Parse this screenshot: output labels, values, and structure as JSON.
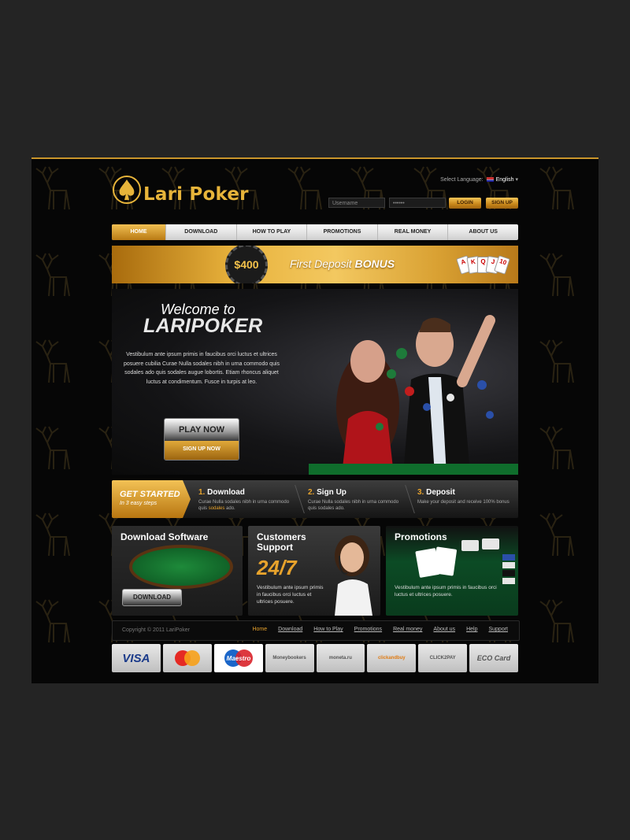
{
  "brand": {
    "name": "Lari Poker",
    "accent": "#e7b43a"
  },
  "language": {
    "label": "Select Language:",
    "value": "English"
  },
  "login": {
    "username_placeholder": "Username",
    "password_placeholder": "••••••",
    "login_label": "LOGIN",
    "signup_label": "SIGN UP"
  },
  "nav": {
    "items": [
      {
        "label": "HOME"
      },
      {
        "label": "DOWNLOAD"
      },
      {
        "label": "HOW TO PLAY"
      },
      {
        "label": "PROMOTIONS"
      },
      {
        "label": "REAL MONEY"
      },
      {
        "label": "ABOUT US"
      }
    ]
  },
  "bonus": {
    "amount": "$400",
    "text": "First Deposit",
    "bold": "BONUS",
    "cards": [
      "A",
      "K",
      "Q",
      "J",
      "10"
    ]
  },
  "hero": {
    "welcome": "Welcome to",
    "brand": "LARIPOKER",
    "paragraph": "Vestibulum ante ipsum primis in faucibus orci luctus et ultrices posuere cubilia Curae Nulla sodales nibh in urna commodo quis sodales ado quis sodales augue lobortis. Etiam rhoncus aliquet luctus at condimentum. Fusce in turpis at leo.",
    "play_label": "PLAY NOW",
    "signup_label": "SIGN UP NOW"
  },
  "get_started": {
    "title": "GET STARTED",
    "subtitle": "In 3 easy steps",
    "steps": [
      {
        "num": "1.",
        "title": "Download",
        "desc": "Curae Nulla sodales nibh in urna commodo quis",
        "highlight": "sodales",
        "tail": "ado."
      },
      {
        "num": "2.",
        "title": "Sign Up",
        "desc": "Curae Nulla sodales nibh in urna commodo quis sodales ado."
      },
      {
        "num": "3.",
        "title": "Deposit",
        "desc": "Make your deposit and receive 100% bonus"
      }
    ]
  },
  "boxes": {
    "download": {
      "title": "Download Software",
      "button": "DOWNLOAD"
    },
    "support": {
      "title1": "Customers",
      "title2": "Support",
      "big": "24/7",
      "desc": "Vestibulum ante ipsum primis in faucibus orci luctus et ultrices posuere."
    },
    "promos": {
      "title": "Promotions",
      "desc": "Vestibulum ante ipsum primis in faucibus orci luctus et ultrices posuere."
    }
  },
  "footer": {
    "copyright": "Copyright © 2011 LariPoker",
    "links": [
      "Home",
      "Download",
      "How to Play",
      "Promotions",
      "Real money",
      "About us",
      "Help",
      "Support"
    ]
  },
  "payments": [
    {
      "label": "VISA",
      "cls": "visa"
    },
    {
      "label": "MasterCard",
      "cls": "mc"
    },
    {
      "label": "Maestro",
      "cls": "mae hl"
    },
    {
      "label": "Moneybookers",
      "cls": ""
    },
    {
      "label": "moneta.ru",
      "cls": ""
    },
    {
      "label": "clickandbuy",
      "cls": ""
    },
    {
      "label": "CLICK2PAY",
      "cls": ""
    },
    {
      "label": "ECO Card",
      "cls": ""
    }
  ]
}
